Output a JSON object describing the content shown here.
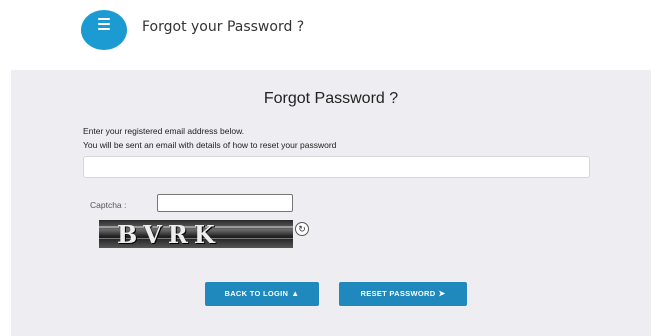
{
  "header": {
    "title": "Forgot your Password ?"
  },
  "panel": {
    "title": "Forgot Password ?",
    "instruction_line1": "Enter your registered email address below.",
    "instruction_line2": "You will be sent an email with details of how to reset your password",
    "email_value": "",
    "captcha_label": "Captcha :",
    "captcha_value": "",
    "captcha_text": "BVRK"
  },
  "buttons": {
    "back_to_login": "BACK TO LOGIN",
    "reset_password": "RESET PASSWORD"
  },
  "icons": {
    "header": "menu-icon",
    "refresh": "refresh-icon",
    "back": "user-icon",
    "reset": "sign-in-icon"
  },
  "colors": {
    "accent": "#1b9bd1",
    "button": "#1f88bd",
    "panel_bg": "#eeeef2"
  }
}
